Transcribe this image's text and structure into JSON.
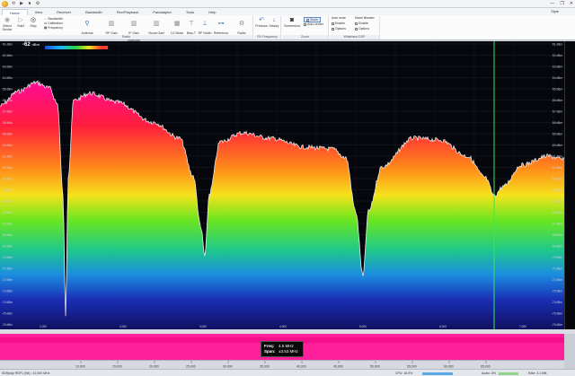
{
  "window": {
    "quick_access": [
      "⟲",
      "▶",
      "⏹",
      "⚙"
    ],
    "controls": [
      "—",
      "❐",
      "✕"
    ]
  },
  "tabs": [
    "Home",
    "View",
    "Receiver",
    "Bandwidth",
    "Rec/Playback",
    "Panadapter",
    "Tools",
    "Help"
  ],
  "style_label": "Style",
  "ribbon": {
    "groups": {
      "radio": "Radio",
      "rx_frequency": "RX Frequency",
      "zoom": "Zoom",
      "wideband_dsp": "Wideband DSP"
    },
    "select_device": "Select Device",
    "start": "Start",
    "stop": "Stop",
    "bandwidth": "Bandwidth",
    "calibration": "Calibration",
    "frequency": "Frequency",
    "antenna": "Antenna\nHigh Impedance",
    "rf_gain": "RF Gain\n4",
    "if_gain": "IF Gain\n-32 dB (Manual)",
    "visual_gain": "Visual Gain\n0 dB",
    "lo_mode": "LO Mode\nAutomatic",
    "bias_t": "Bias-T\nOff",
    "rf_notch": "RF Notch\nOff",
    "reference": "Reference\nOff",
    "radio_config": "Radio\nConfiguration",
    "previous": "Previous",
    "history": "History",
    "screenshot": "Screenshot",
    "zoom_btn": "Zoom",
    "auto_center": "Auto center",
    "auto_mute": "Auto mute",
    "noise_blanker": "Noise Blanker",
    "enable": "Enable",
    "options": "Options"
  },
  "spectrum": {
    "level": "-62",
    "level_unit": "dBm",
    "db_labels": [
      "-51 dBm",
      "-52 dBm",
      "-53 dBm",
      "-54 dBm",
      "-55 dBm",
      "-56 dBm",
      "-57 dBm",
      "-58 dBm",
      "-59 dBm",
      "-60 dBm",
      "-61 dBm",
      "-62 dBm",
      "-63 dBm",
      "-64 dBm",
      "-65 dBm",
      "-66 dBm",
      "-67 dBm",
      "-68 dBm",
      "-69 dBm",
      "-70 dBm",
      "-71 dBm",
      "-72 dBm",
      "-73 dBm",
      "-74 dBm",
      "-75 dBm",
      "-76 dBm"
    ],
    "top_freqs": [
      "1,000",
      "2,000",
      "3,000",
      "4,000",
      "5,000",
      "6,000",
      "7,000"
    ],
    "trace_color": "#e8e8e8",
    "cursor_color": "#38e65a"
  },
  "tuning": {
    "freq_label": "Freq:",
    "freq_value": "4.5 MHz",
    "span_label": "Span:",
    "span_value": "±3.53 MHz"
  },
  "freqscale": [
    "10,000",
    "15,000",
    "20,000",
    "25,000",
    "30,000",
    "35,000",
    "40,000",
    "45,000",
    "50,000",
    "55,000",
    "60,000",
    "65,000"
  ],
  "status": {
    "left": "SDRplay RSP1 (Wi) • 10,000 MHz",
    "cpu": "CPU: 16.9%",
    "audio": "Audio: 0%",
    "rate": "Rate: 3.1 MB"
  }
}
